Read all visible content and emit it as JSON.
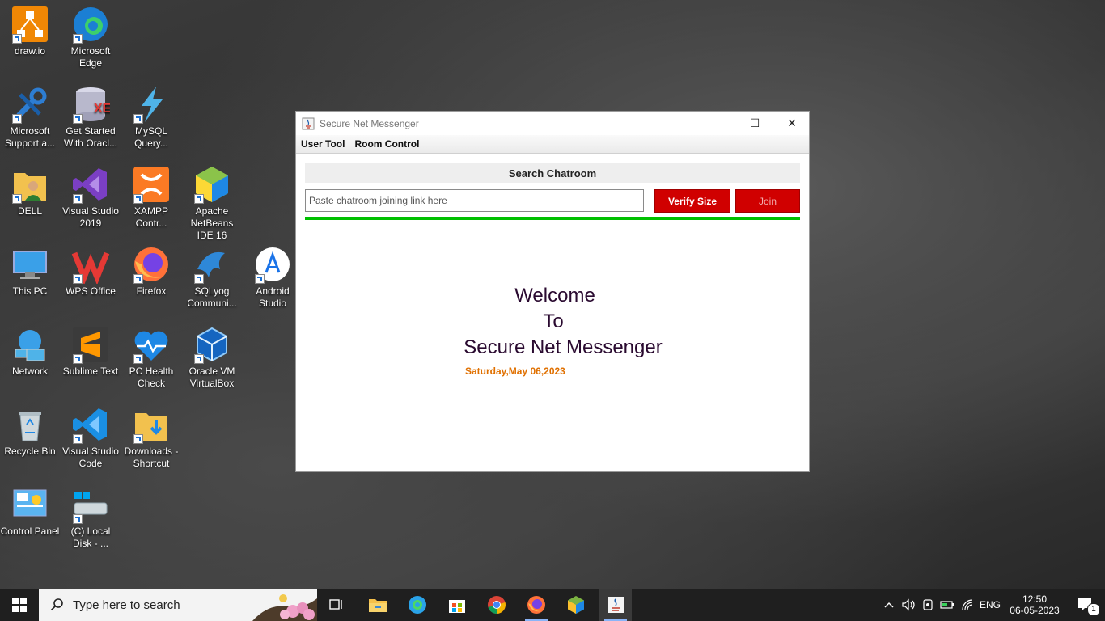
{
  "desktop": {
    "icons": [
      {
        "id": "drawio",
        "label": "draw.io"
      },
      {
        "id": "edge",
        "label": "Microsoft Edge"
      },
      {
        "id": "ms-support",
        "label": "Microsoft Support a..."
      },
      {
        "id": "oracle",
        "label": "Get Started With Oracl..."
      },
      {
        "id": "mysql",
        "label": "MySQL Query..."
      },
      {
        "id": "dell",
        "label": "DELL"
      },
      {
        "id": "vs2019",
        "label": "Visual Studio 2019"
      },
      {
        "id": "xampp",
        "label": "XAMPP Contr..."
      },
      {
        "id": "netbeans",
        "label": "Apache NetBeans IDE 16"
      },
      {
        "id": "thispc",
        "label": "This PC"
      },
      {
        "id": "wps",
        "label": "WPS Office"
      },
      {
        "id": "firefox",
        "label": "Firefox"
      },
      {
        "id": "sqlyog",
        "label": "SQLyog Communi..."
      },
      {
        "id": "android",
        "label": "Android Studio"
      },
      {
        "id": "network",
        "label": "Network"
      },
      {
        "id": "sublime",
        "label": "Sublime Text"
      },
      {
        "id": "pchealth",
        "label": "PC Health Check"
      },
      {
        "id": "vbox",
        "label": "Oracle VM VirtualBox"
      },
      {
        "id": "recycle",
        "label": "Recycle Bin"
      },
      {
        "id": "vscode",
        "label": "Visual Studio Code"
      },
      {
        "id": "downloads",
        "label": "Downloads - Shortcut"
      },
      {
        "id": "control",
        "label": "Control Panel"
      },
      {
        "id": "localdisk",
        "label": "(C) Local Disk - ..."
      }
    ]
  },
  "window": {
    "title": "Secure Net Messenger",
    "controls": {
      "minimize": "—",
      "maximize": "☐",
      "close": "✕"
    },
    "menus": [
      "User Tool",
      "Room Control"
    ],
    "search_header": "Search Chatroom",
    "link_placeholder": "Paste chatroom joining link here",
    "verify_label": "Verify Size",
    "join_label": "Join",
    "welcome_lines": [
      "Welcome",
      "To",
      "Secure Net Messenger"
    ],
    "date": "Saturday,May 06,2023",
    "colors": {
      "button_red": "#d00000",
      "progress_green": "#00c000",
      "date_orange": "#e07000"
    }
  },
  "taskbar": {
    "search_placeholder": "Type here to search",
    "language": "ENG",
    "time": "12:50",
    "date": "06-05-2023",
    "notification_count": "1"
  }
}
